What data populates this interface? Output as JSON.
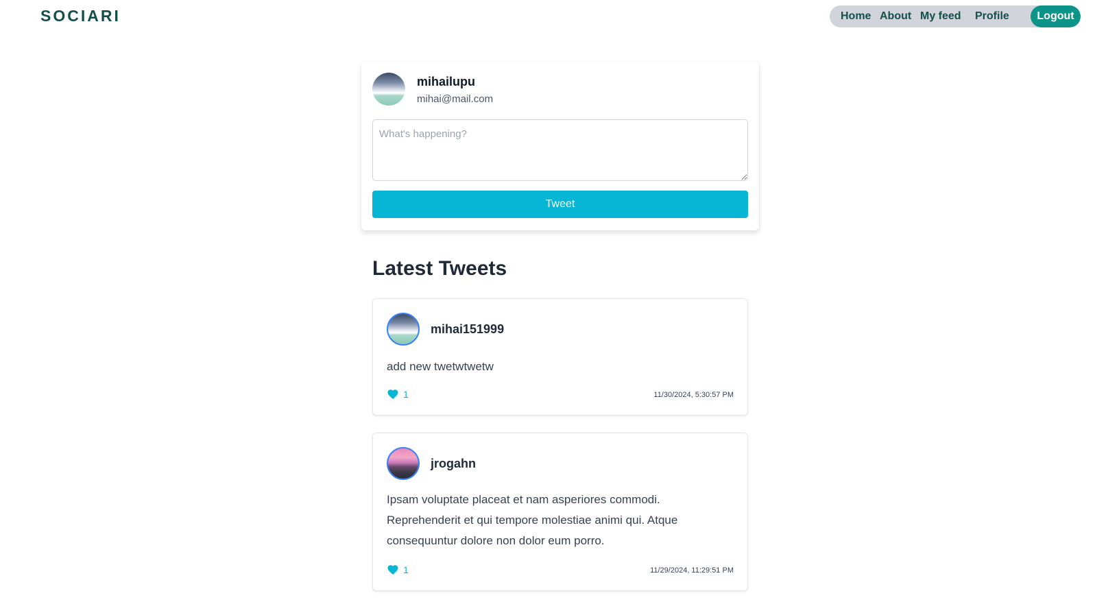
{
  "header": {
    "brand": "SOCIARI",
    "nav": {
      "home": "Home",
      "about": "About",
      "feed": "My feed",
      "profile": "Profile",
      "logout": "Logout"
    }
  },
  "compose": {
    "username": "mihailupu",
    "email": "mihai@mail.com",
    "placeholder": "What's happening?",
    "button": "Tweet"
  },
  "feed": {
    "title": "Latest Tweets",
    "tweets": [
      {
        "user": "mihai151999",
        "text": "add new twetwtwetw",
        "likes": "1",
        "time": "11/30/2024, 5:30:57 PM",
        "avatar_icon": "profile-photo-sea"
      },
      {
        "user": "jrogahn",
        "text": "Ipsam voluptate placeat et nam asperiores commodi. Reprehenderit et qui tempore molestiae animi qui. Atque consequuntur dolore non dolor eum porro.",
        "likes": "1",
        "time": "11/29/2024, 11:29:51 PM",
        "avatar_icon": "profile-photo-sunset"
      }
    ]
  },
  "colors": {
    "brand": "#134e4a",
    "logout": "#0d9488",
    "accent": "#06b6d4",
    "nav_bg": "#d1d5db"
  }
}
